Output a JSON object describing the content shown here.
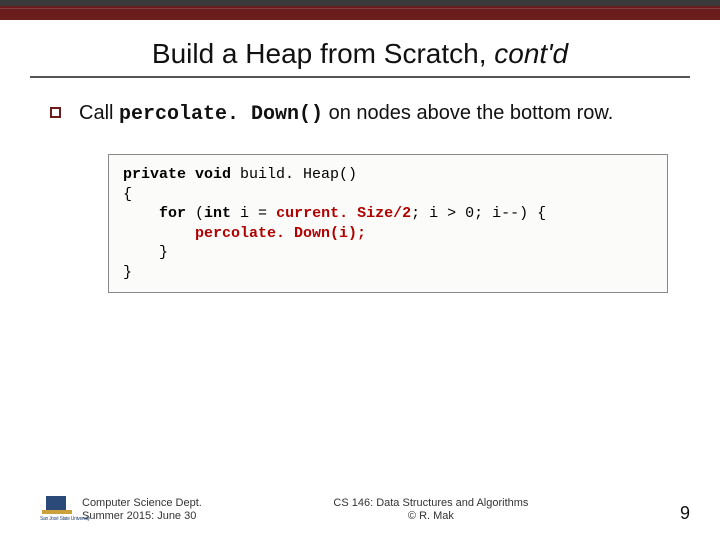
{
  "title": {
    "prefix": "Build a Heap from Scratch, ",
    "italic": "cont'd"
  },
  "bullet": {
    "pre": "Call ",
    "mono": "percolate. Down()",
    "post": " on nodes above the bottom row."
  },
  "code": {
    "line1a": "private void",
    "line1b": " build. Heap()",
    "line2": "{",
    "line3a": "    for",
    "line3b": " (",
    "line3c": "int",
    "line3d": " i = ",
    "line3e": "current. Size/2",
    "line3f": "; i > 0; i--) {",
    "line4a": "        ",
    "line4b": "percolate. Down(i);",
    "line5": "    }",
    "line6": "}"
  },
  "footer": {
    "logo_name": "San José State University",
    "dept1": "Computer Science Dept.",
    "dept2": "Summer 2015: June 30",
    "course1": "CS 146: Data Structures and Algorithms",
    "course2": "© R. Mak",
    "page": "9"
  }
}
